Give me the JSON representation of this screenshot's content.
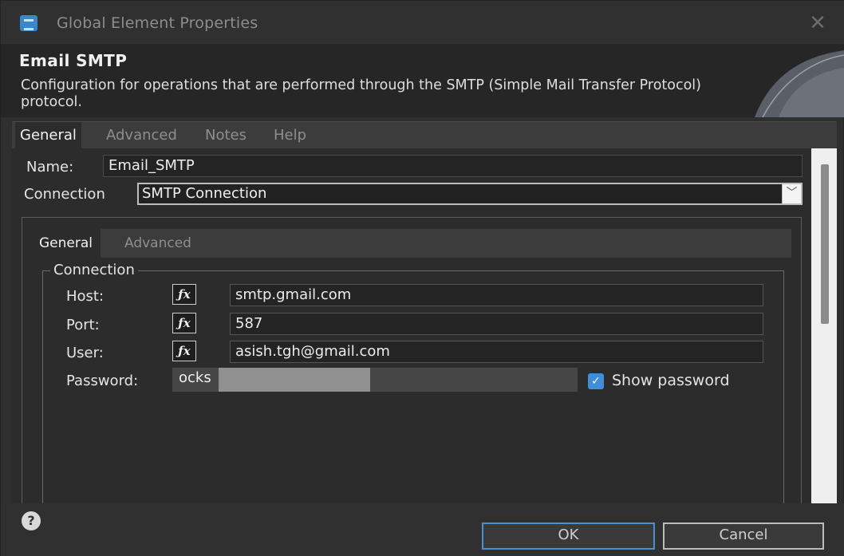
{
  "window": {
    "title": "Global Element Properties",
    "close_glyph": "✕"
  },
  "header": {
    "title": "Email SMTP",
    "description": "Configuration for operations that are performed through the SMTP (Simple Mail Transfer Protocol) protocol."
  },
  "tabs": [
    {
      "label": "General",
      "active": true
    },
    {
      "label": "Advanced",
      "active": false
    },
    {
      "label": "Notes",
      "active": false
    },
    {
      "label": "Help",
      "active": false
    }
  ],
  "form": {
    "name_label": "Name:",
    "name_value": "Email_SMTP",
    "connection_label": "Connection",
    "connection_value": "SMTP Connection",
    "dropdown_glyph": "﹀"
  },
  "inner_tabs": [
    {
      "label": "General",
      "active": true
    },
    {
      "label": "Advanced",
      "active": false
    }
  ],
  "connection_group": {
    "legend": "Connection",
    "fx_label": "ƒx",
    "fields": [
      {
        "label": "Host:",
        "value": "smtp.gmail.com"
      },
      {
        "label": "Port:",
        "value": "587"
      },
      {
        "label": "User:",
        "value": "asish.tgh@gmail.com"
      }
    ],
    "password_label": "Password:",
    "password_value": "ocks",
    "show_password_label": "Show password",
    "show_password_checked": true,
    "check_glyph": "✓"
  },
  "footer": {
    "help_glyph": "?",
    "ok_label": "OK",
    "cancel_label": "Cancel"
  },
  "colors": {
    "accent": "#3f8fd8",
    "background": "#2c2c2c"
  }
}
